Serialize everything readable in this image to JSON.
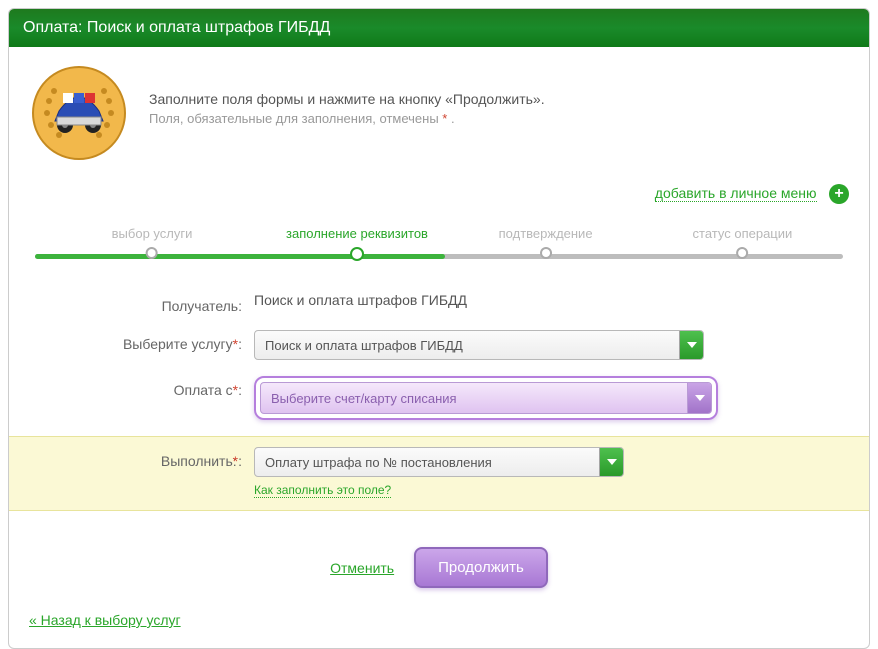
{
  "header": {
    "title": "Оплата: Поиск и оплата штрафов ГИБДД"
  },
  "intro": {
    "main": "Заполните поля формы и нажмите на кнопку «Продолжить».",
    "hint_prefix": "Поля, обязательные для заполнения, отмечены ",
    "hint_star": "*",
    "hint_suffix": " ."
  },
  "add_menu": {
    "label": "добавить в личное меню"
  },
  "progress": {
    "steps": [
      {
        "label": "выбор услуги",
        "pos": 15,
        "active": false
      },
      {
        "label": "заполнение реквизитов",
        "pos": 40,
        "active": true
      },
      {
        "label": "подтверждение",
        "pos": 63,
        "active": false
      },
      {
        "label": "статус операции",
        "pos": 87,
        "active": false
      }
    ],
    "fill_pct": 50
  },
  "form": {
    "recipient": {
      "label": "Получатель:",
      "value": "Поиск и оплата штрафов ГИБДД"
    },
    "service": {
      "label": "Выберите услугу",
      "value": "Поиск и оплата штрафов ГИБДД"
    },
    "pay_from": {
      "label": "Оплата с",
      "placeholder": "Выберите счет/карту списания"
    },
    "execute": {
      "label": "Выполнить:",
      "value": "Оплату штрафа по № постановления",
      "help": "Как заполнить это поле?"
    }
  },
  "actions": {
    "cancel": "Отменить",
    "continue": "Продолжить"
  },
  "back": {
    "label": "« Назад к выбору услуг"
  }
}
